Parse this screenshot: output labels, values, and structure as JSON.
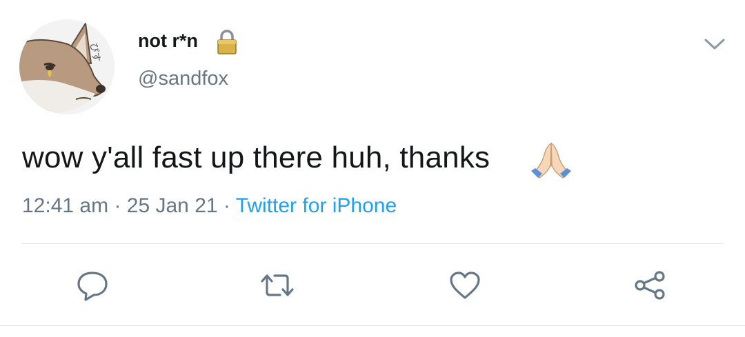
{
  "tweet": {
    "display_name": "not r*n",
    "handle": "@sandfox",
    "text": "wow y'all fast up there huh, thanks",
    "emoji": "folded-hands",
    "time": "12:41 am",
    "separator": "·",
    "date": "25 Jan 21",
    "source": "Twitter for iPhone",
    "protected": true,
    "avatar_text": "ぴす"
  },
  "icons": {
    "lock": "lock-icon",
    "caret": "chevron-down-icon",
    "reply": "reply-icon",
    "retweet": "retweet-icon",
    "like": "heart-icon",
    "share": "share-icon"
  },
  "colors": {
    "text": "#14171a",
    "secondary": "#657786",
    "link": "#1da1f2",
    "icon": "#657786",
    "divider": "#e1e8ed"
  }
}
